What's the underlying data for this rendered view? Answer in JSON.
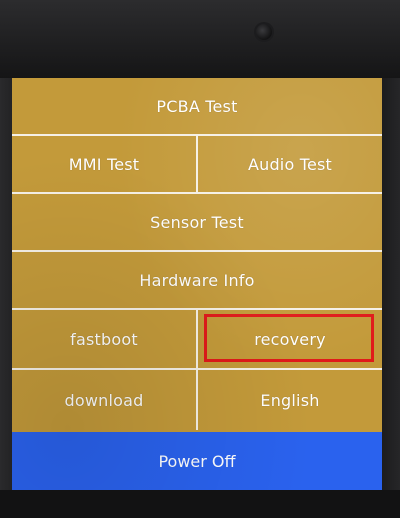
{
  "menu": {
    "pcba_test": "PCBA Test",
    "mmi_test": "MMI Test",
    "audio_test": "Audio Test",
    "sensor_test": "Sensor Test",
    "hardware_info": "Hardware Info",
    "fastboot": "fastboot",
    "recovery": "recovery",
    "download": "download",
    "english": "English",
    "power_off": "Power Off"
  },
  "colors": {
    "menu_background": "#c39a3a",
    "divider": "#f5f0e6",
    "power_button": "#2a62ee",
    "highlight_border": "#e01a1a",
    "text": "#ffffff"
  }
}
